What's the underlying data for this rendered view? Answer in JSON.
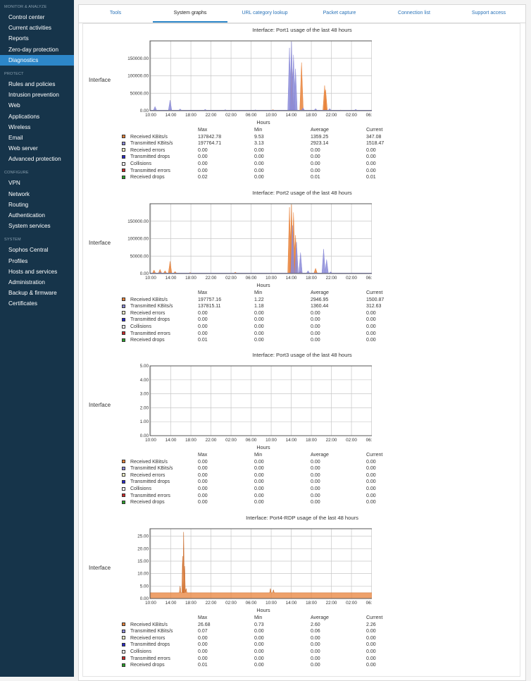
{
  "sidebar": {
    "sections": [
      {
        "title": "MONITOR & ANALYZE",
        "items": [
          "Control center",
          "Current activities",
          "Reports",
          "Zero-day protection",
          "Diagnostics"
        ]
      },
      {
        "title": "PROTECT",
        "items": [
          "Rules and policies",
          "Intrusion prevention",
          "Web",
          "Applications",
          "Wireless",
          "Email",
          "Web server",
          "Advanced protection"
        ]
      },
      {
        "title": "CONFIGURE",
        "items": [
          "VPN",
          "Network",
          "Routing",
          "Authentication",
          "System services"
        ]
      },
      {
        "title": "SYSTEM",
        "items": [
          "Sophos Central",
          "Profiles",
          "Hosts and services",
          "Administration",
          "Backup & firmware",
          "Certificates"
        ]
      }
    ],
    "active_item": "Diagnostics"
  },
  "tabs": {
    "items": [
      "Tools",
      "System graphs",
      "URL category lookup",
      "Packet capture",
      "Connection list",
      "Support access"
    ],
    "active": "System graphs"
  },
  "legend_colors": {
    "received_kbits": "#e8823a",
    "transmitted_kbits": "#8b8bd8",
    "received_errors": "#ffffcc",
    "transmitted_drops": "#2a2acc",
    "collisions": "#ffffff",
    "transmitted_errors": "#cc2a2a",
    "received_drops": "#2aa02a"
  },
  "stats_header": {
    "max": "Max",
    "min": "Min",
    "average": "Average",
    "current": "Current"
  },
  "graphs": [
    {
      "title": "Interface: Port1 usage of the last 48 hours",
      "side_label": "Interface",
      "xlabel": "Hours",
      "stats": [
        {
          "name": "Received KBits/s",
          "color": "received_kbits",
          "max": "137842.78",
          "min": "9.53",
          "avg": "1359.25",
          "cur": "347.08"
        },
        {
          "name": "Transmitted KBits/s",
          "color": "transmitted_kbits",
          "max": "197764.71",
          "min": "3.13",
          "avg": "2923.14",
          "cur": "1518.47"
        },
        {
          "name": "Received errors",
          "color": "received_errors",
          "max": "0.00",
          "min": "0.00",
          "avg": "0.00",
          "cur": "0.00"
        },
        {
          "name": "Transmitted drops",
          "color": "transmitted_drops",
          "max": "0.00",
          "min": "0.00",
          "avg": "0.00",
          "cur": "0.00"
        },
        {
          "name": "Collisions",
          "color": "collisions",
          "max": "0.00",
          "min": "0.00",
          "avg": "0.00",
          "cur": "0.00"
        },
        {
          "name": "Transmitted errors",
          "color": "transmitted_errors",
          "max": "0.00",
          "min": "0.00",
          "avg": "0.00",
          "cur": "0.00"
        },
        {
          "name": "Received drops",
          "color": "received_drops",
          "max": "0.02",
          "min": "0.00",
          "avg": "0.01",
          "cur": "0.01"
        }
      ]
    },
    {
      "title": "Interface: Port2 usage of the last 48 hours",
      "side_label": "Interface",
      "xlabel": "Hours",
      "stats": [
        {
          "name": "Received KBits/s",
          "color": "received_kbits",
          "max": "197757.16",
          "min": "1.22",
          "avg": "2946.95",
          "cur": "1500.87"
        },
        {
          "name": "Transmitted KBits/s",
          "color": "transmitted_kbits",
          "max": "137815.11",
          "min": "1.18",
          "avg": "1360.44",
          "cur": "312.63"
        },
        {
          "name": "Received errors",
          "color": "received_errors",
          "max": "0.00",
          "min": "0.00",
          "avg": "0.00",
          "cur": "0.00"
        },
        {
          "name": "Transmitted drops",
          "color": "transmitted_drops",
          "max": "0.00",
          "min": "0.00",
          "avg": "0.00",
          "cur": "0.00"
        },
        {
          "name": "Collisions",
          "color": "collisions",
          "max": "0.00",
          "min": "0.00",
          "avg": "0.00",
          "cur": "0.00"
        },
        {
          "name": "Transmitted errors",
          "color": "transmitted_errors",
          "max": "0.00",
          "min": "0.00",
          "avg": "0.00",
          "cur": "0.00"
        },
        {
          "name": "Received drops",
          "color": "received_drops",
          "max": "0.01",
          "min": "0.00",
          "avg": "0.00",
          "cur": "0.00"
        }
      ]
    },
    {
      "title": "Interface: Port3 usage of the last 48 hours",
      "side_label": "Interface",
      "xlabel": "Hours",
      "stats": [
        {
          "name": "Received KBits/s",
          "color": "received_kbits",
          "max": "0.00",
          "min": "0.00",
          "avg": "0.00",
          "cur": "0.00"
        },
        {
          "name": "Transmitted KBits/s",
          "color": "transmitted_kbits",
          "max": "0.00",
          "min": "0.00",
          "avg": "0.00",
          "cur": "0.00"
        },
        {
          "name": "Received errors",
          "color": "received_errors",
          "max": "0.00",
          "min": "0.00",
          "avg": "0.00",
          "cur": "0.00"
        },
        {
          "name": "Transmitted drops",
          "color": "transmitted_drops",
          "max": "0.00",
          "min": "0.00",
          "avg": "0.00",
          "cur": "0.00"
        },
        {
          "name": "Collisions",
          "color": "collisions",
          "max": "0.00",
          "min": "0.00",
          "avg": "0.00",
          "cur": "0.00"
        },
        {
          "name": "Transmitted errors",
          "color": "transmitted_errors",
          "max": "0.00",
          "min": "0.00",
          "avg": "0.00",
          "cur": "0.00"
        },
        {
          "name": "Received drops",
          "color": "received_drops",
          "max": "0.00",
          "min": "0.00",
          "avg": "0.00",
          "cur": "0.00"
        }
      ]
    },
    {
      "title": "Interface: Port4-RDP usage of the last 48 hours",
      "side_label": "Interface",
      "xlabel": "Hours",
      "stats": [
        {
          "name": "Received KBits/s",
          "color": "received_kbits",
          "max": "26.68",
          "min": "0.73",
          "avg": "2.60",
          "cur": "2.26"
        },
        {
          "name": "Transmitted KBits/s",
          "color": "transmitted_kbits",
          "max": "0.07",
          "min": "0.00",
          "avg": "0.06",
          "cur": "0.00"
        },
        {
          "name": "Received errors",
          "color": "received_errors",
          "max": "0.00",
          "min": "0.00",
          "avg": "0.00",
          "cur": "0.00"
        },
        {
          "name": "Transmitted drops",
          "color": "transmitted_drops",
          "max": "0.00",
          "min": "0.00",
          "avg": "0.00",
          "cur": "0.00"
        },
        {
          "name": "Collisions",
          "color": "collisions",
          "max": "0.00",
          "min": "0.00",
          "avg": "0.00",
          "cur": "0.00"
        },
        {
          "name": "Transmitted errors",
          "color": "transmitted_errors",
          "max": "0.00",
          "min": "0.00",
          "avg": "0.00",
          "cur": "0.00"
        },
        {
          "name": "Received drops",
          "color": "received_drops",
          "max": "0.01",
          "min": "0.00",
          "avg": "0.00",
          "cur": "0.00"
        }
      ]
    }
  ],
  "chart_data": [
    {
      "type": "area",
      "title": "Interface: Port1 usage of the last 48 hours",
      "xlabel": "Hours",
      "x_ticks": [
        "10:00",
        "14:00",
        "18:00",
        "22:00",
        "02:00",
        "06:00",
        "10:00",
        "14:00",
        "18:00",
        "22:00",
        "02:00",
        "06:00"
      ],
      "y_ticks": [
        "0.00",
        "50000.00",
        "100000.00",
        "150000.00"
      ],
      "ylim": [
        0,
        200000
      ],
      "grid": true,
      "series": [
        {
          "name": "Received KBits/s",
          "color": "#e8823a",
          "spikes": [
            [
              0.96,
              1500
            ],
            [
              28.3,
              120000
            ],
            [
              30.2,
              137843
            ],
            [
              34.8,
              72000
            ],
            [
              35.0,
              60000
            ],
            [
              24.5,
              3000
            ],
            [
              38,
              2000
            ],
            [
              42,
              1500
            ],
            [
              47.8,
              1000
            ]
          ]
        },
        {
          "name": "Transmitted KBits/s",
          "color": "#8b8bd8",
          "spikes": [
            [
              1.0,
              12000
            ],
            [
              4.0,
              30000
            ],
            [
              6.0,
              5000
            ],
            [
              11.0,
              4000
            ],
            [
              15.0,
              3000
            ],
            [
              21.0,
              2500
            ],
            [
              27.8,
              180000
            ],
            [
              28.2,
              197765
            ],
            [
              28.6,
              160000
            ],
            [
              29.0,
              120000
            ],
            [
              30.5,
              8000
            ],
            [
              33.0,
              6000
            ],
            [
              35.8,
              6000
            ],
            [
              41.0,
              4000
            ],
            [
              47.9,
              14000
            ]
          ]
        }
      ]
    },
    {
      "type": "area",
      "title": "Interface: Port2 usage of the last 48 hours",
      "xlabel": "Hours",
      "x_ticks": [
        "10:00",
        "14:00",
        "18:00",
        "22:00",
        "02:00",
        "06:00",
        "10:00",
        "14:00",
        "18:00",
        "22:00",
        "02:00",
        "06:00"
      ],
      "y_ticks": [
        "0.00",
        "50000.00",
        "100000.00",
        "150000.00"
      ],
      "ylim": [
        0,
        200000
      ],
      "grid": true,
      "series": [
        {
          "name": "Received KBits/s",
          "color": "#e8823a",
          "spikes": [
            [
              0.8,
              10000
            ],
            [
              2.0,
              12000
            ],
            [
              3.0,
              8000
            ],
            [
              4.0,
              35000
            ],
            [
              5.0,
              6000
            ],
            [
              8.0,
              3000
            ],
            [
              17.0,
              4000
            ],
            [
              27.8,
              190000
            ],
            [
              28.2,
              197757
            ],
            [
              28.6,
              175000
            ],
            [
              29.0,
              110000
            ],
            [
              30.0,
              8000
            ],
            [
              33.0,
              15000
            ],
            [
              47.8,
              14000
            ]
          ]
        },
        {
          "name": "Transmitted KBits/s",
          "color": "#8b8bd8",
          "spikes": [
            [
              2.0,
              4000
            ],
            [
              28.4,
              137815
            ],
            [
              29.2,
              90000
            ],
            [
              30.0,
              60000
            ],
            [
              31.5,
              8000
            ],
            [
              34.6,
              70000
            ],
            [
              35.2,
              40000
            ],
            [
              36.0,
              5000
            ]
          ]
        }
      ]
    },
    {
      "type": "area",
      "title": "Interface: Port3 usage of the last 48 hours",
      "xlabel": "Hours",
      "x_ticks": [
        "10:00",
        "14:00",
        "18:00",
        "22:00",
        "02:00",
        "06:00",
        "10:00",
        "14:00",
        "18:00",
        "22:00",
        "02:00",
        "06:00"
      ],
      "y_ticks": [
        "0.00",
        "1.00",
        "2.00",
        "3.00",
        "4.00",
        "5.00"
      ],
      "ylim": [
        0,
        5
      ],
      "grid": true,
      "series": []
    },
    {
      "type": "area",
      "title": "Interface: Port4-RDP usage of the last 48 hours",
      "xlabel": "Hours",
      "x_ticks": [
        "10:00",
        "14:00",
        "18:00",
        "22:00",
        "02:00",
        "06:00",
        "10:00",
        "14:00",
        "18:00",
        "22:00",
        "02:00",
        "06:00"
      ],
      "y_ticks": [
        "0.00",
        "5.00",
        "10.00",
        "15.00",
        "20.00",
        "25.00"
      ],
      "ylim": [
        0,
        28
      ],
      "grid": true,
      "series": [
        {
          "name": "Received KBits/s",
          "color": "#e8823a",
          "baseline": 2.3,
          "spikes": [
            [
              6.0,
              5
            ],
            [
              6.5,
              17
            ],
            [
              6.7,
              26.68
            ],
            [
              6.9,
              13
            ],
            [
              7.2,
              4
            ],
            [
              24.0,
              4
            ],
            [
              24.6,
              3.5
            ]
          ]
        }
      ]
    }
  ]
}
